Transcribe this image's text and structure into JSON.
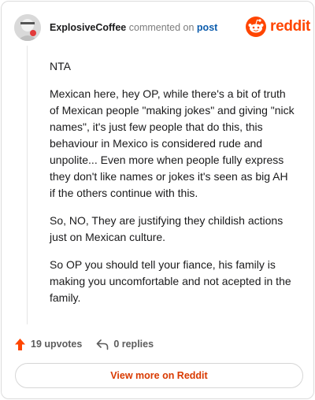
{
  "header": {
    "username": "ExplosiveCoffee",
    "action": "commented on",
    "link": "post",
    "logo_text": "reddit",
    "logo_color": "#ff4500"
  },
  "comment": {
    "paragraphs": [
      "NTA",
      "Mexican here, hey OP, while there's a bit of truth of Mexican people \"making jokes\" and giving \"nick names\", it's just few people that do this, this behaviour in Mexico is considered rude and unpolite... Even more when people fully express they don't like names or jokes it's seen as big AH if the others continue with this.",
      "So, NO, They are justifying they childish actions just on Mexican culture.",
      "So OP you should tell your fiance, his family is making you uncomfortable and not acepted in the family."
    ]
  },
  "footer": {
    "upvotes_label": "19 upvotes",
    "replies_label": "0 replies",
    "view_more_label": "View more on Reddit",
    "upvote_icon": "upvote-arrow-icon",
    "reply_icon": "reply-arrow-icon"
  }
}
